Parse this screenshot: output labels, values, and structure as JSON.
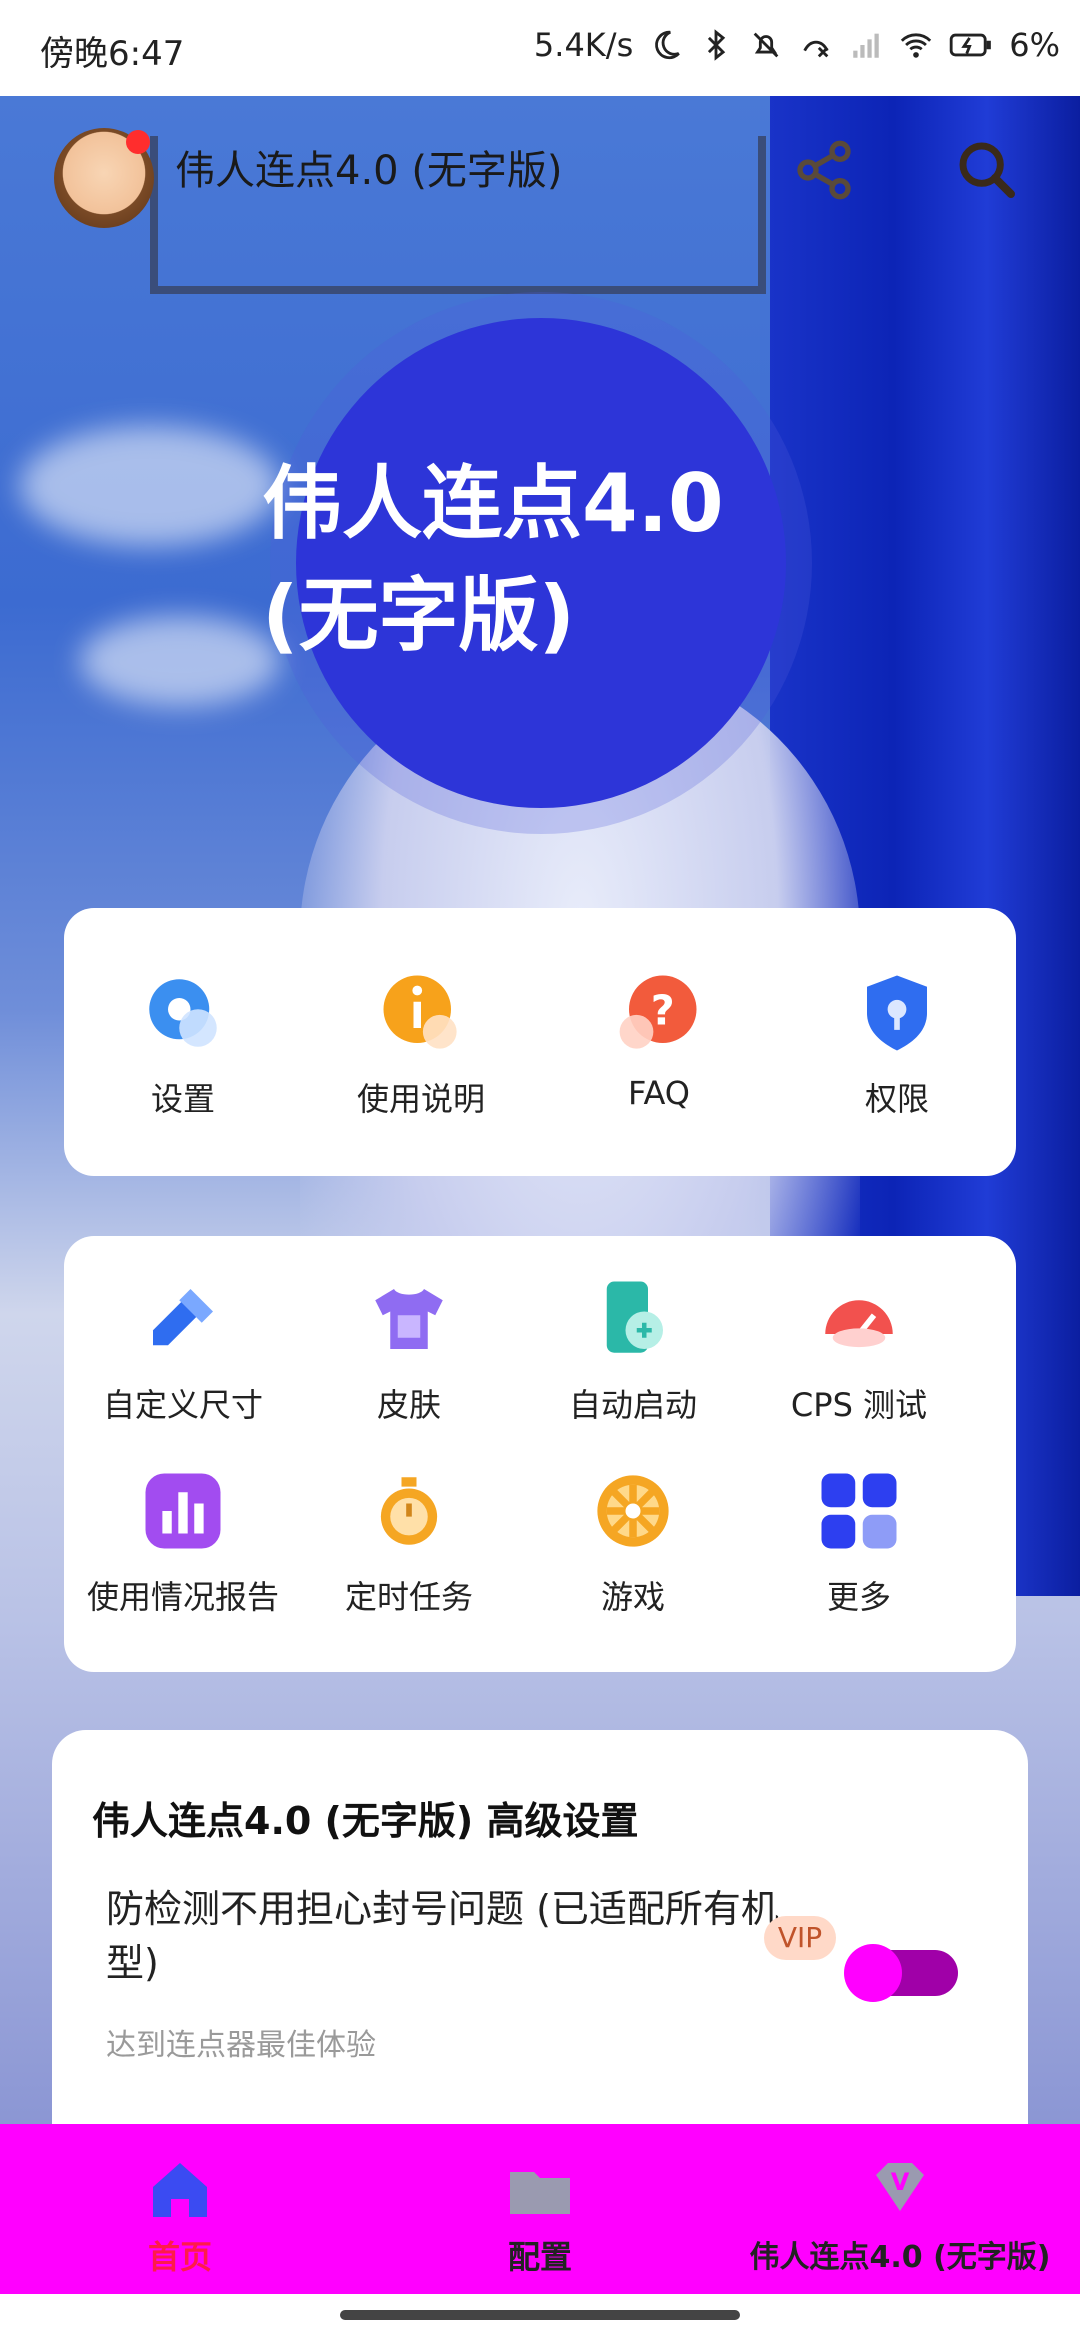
{
  "status_bar": {
    "time": "傍晚6:47",
    "net_speed": "5.4K/s",
    "battery": "6%"
  },
  "app_bar": {
    "title": "伟人连点4.0 (无字版)",
    "share_icon": "share-icon",
    "search_icon": "search-icon"
  },
  "hero": {
    "line1": "伟人连点4.0",
    "line2": "(无字版)"
  },
  "quick_menu": [
    {
      "label": "设置",
      "icon": "gear-icon"
    },
    {
      "label": "使用说明",
      "icon": "info-icon"
    },
    {
      "label": "FAQ",
      "icon": "question-icon"
    },
    {
      "label": "权限",
      "icon": "shield-icon"
    }
  ],
  "tools": [
    {
      "label": "自定义尺寸",
      "icon": "ruler-pencil-icon"
    },
    {
      "label": "皮肤",
      "icon": "tshirt-icon"
    },
    {
      "label": "自动启动",
      "icon": "phone-link-icon"
    },
    {
      "label": "CPS 测试",
      "icon": "speedometer-icon"
    },
    {
      "label": "使用情况报告",
      "icon": "bar-chart-icon"
    },
    {
      "label": "定时任务",
      "icon": "stopwatch-icon"
    },
    {
      "label": "游戏",
      "icon": "wheel-icon"
    },
    {
      "label": "更多",
      "icon": "grid-icon"
    }
  ],
  "advanced": {
    "title": "伟人连点4.0 (无字版) 高级设置",
    "option_text": "防检测不用担心封号问题 (已适配所有机型)",
    "option_sub": "达到连点器最佳体验",
    "vip_badge": "VIP",
    "toggle_on": true
  },
  "bottom_nav": [
    {
      "label": "首页",
      "icon": "home-icon",
      "active": true
    },
    {
      "label": "配置",
      "icon": "folder-icon",
      "active": false
    },
    {
      "label": "伟人连点4.0 (无字版)",
      "icon": "diamond-v-icon",
      "active": false
    }
  ],
  "colors": {
    "hero": "#2d35d8",
    "bottom_nav": "#ff00ff",
    "active_nav": "#ff1a4a",
    "toggle_knob": "#ff00ff"
  }
}
